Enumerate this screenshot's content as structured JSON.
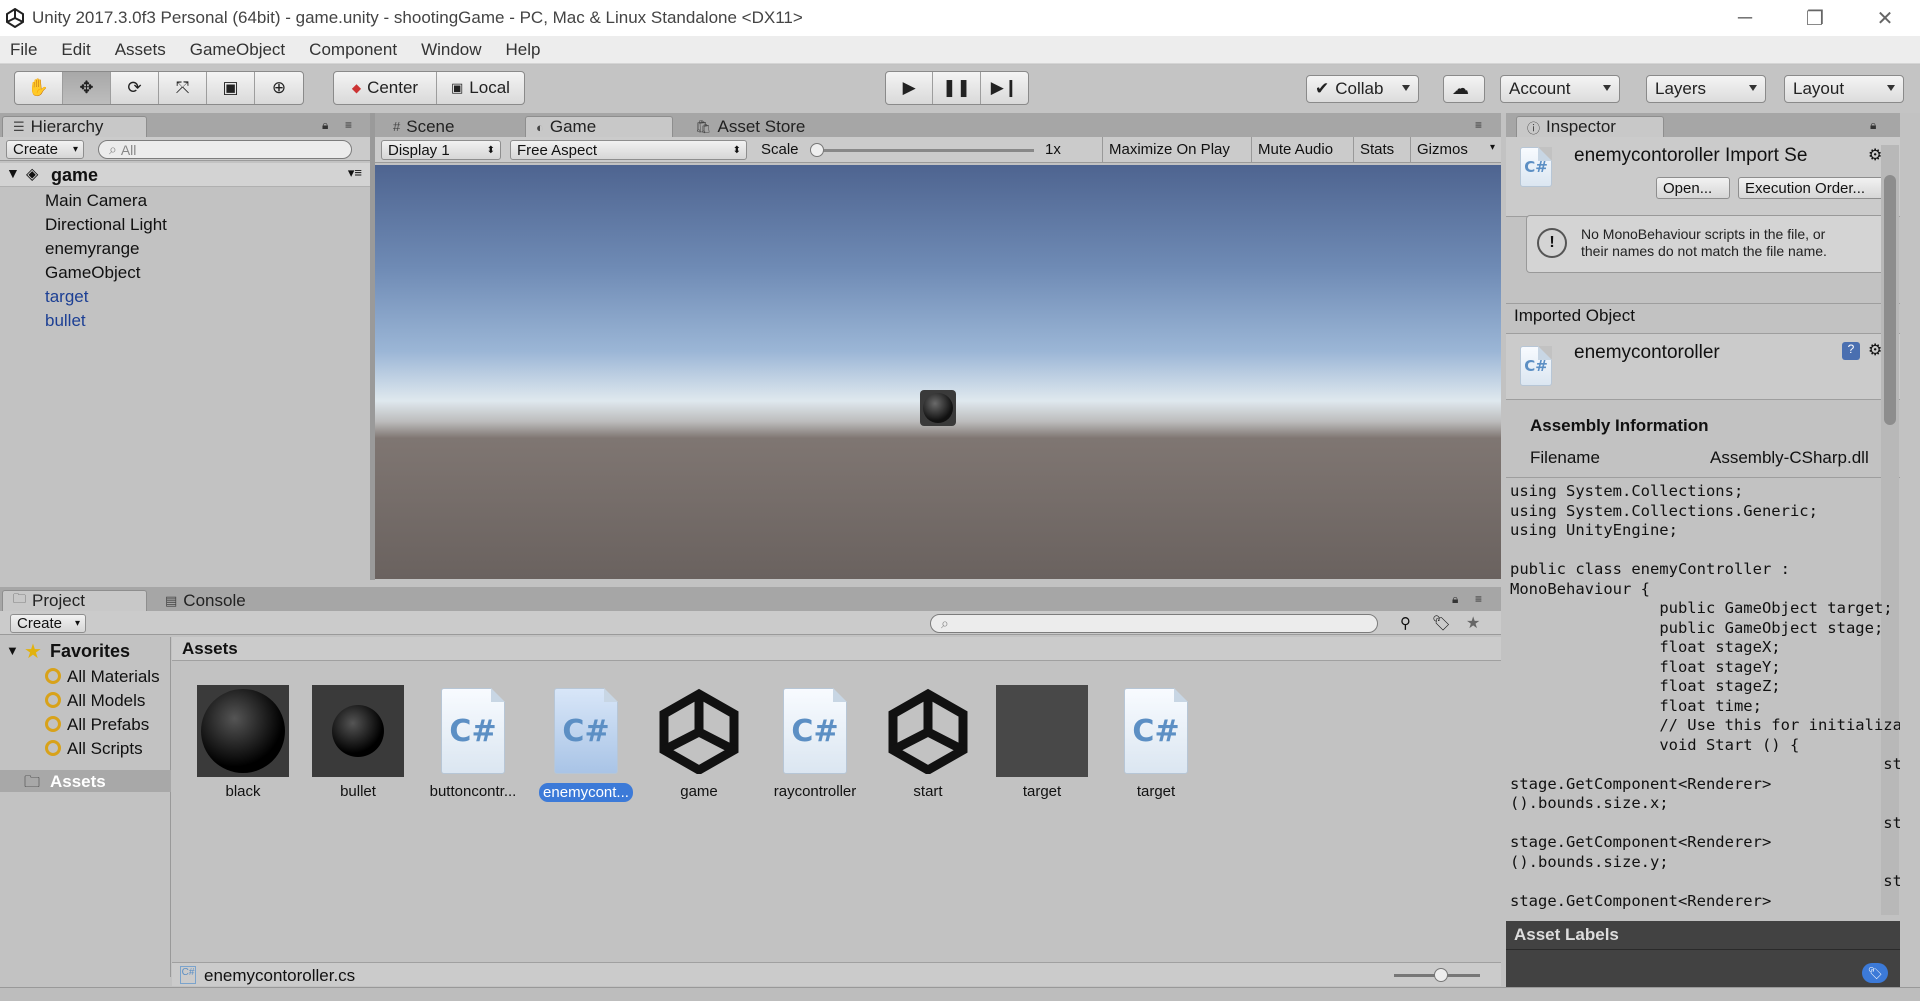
{
  "window": {
    "title": "Unity 2017.3.0f3 Personal (64bit) - game.unity - shootingGame - PC, Mac & Linux Standalone <DX11>"
  },
  "menu": [
    "File",
    "Edit",
    "Assets",
    "GameObject",
    "Component",
    "Window",
    "Help"
  ],
  "toolbar": {
    "pivot": "Center",
    "space": "Local",
    "collab": "Collab",
    "account": "Account",
    "layers": "Layers",
    "layout": "Layout"
  },
  "hierarchy": {
    "tab": "Hierarchy",
    "create": "Create",
    "search_placeholder": "All",
    "scene": "game",
    "items": [
      {
        "label": "Main Camera",
        "color": "#111111"
      },
      {
        "label": "Directional Light",
        "color": "#111111"
      },
      {
        "label": "enemyrange",
        "color": "#111111"
      },
      {
        "label": "GameObject",
        "color": "#111111"
      },
      {
        "label": "target",
        "color": "#1c3f94"
      },
      {
        "label": "bullet",
        "color": "#1c3f94"
      }
    ]
  },
  "center_tabs": {
    "scene": "Scene",
    "game": "Game",
    "asset_store": "Asset Store"
  },
  "game_bar": {
    "display": "Display 1",
    "aspect": "Free Aspect",
    "scale_label": "Scale",
    "scale_value": "1x",
    "maximize": "Maximize On Play",
    "mute": "Mute Audio",
    "stats": "Stats",
    "gizmos": "Gizmos"
  },
  "inspector": {
    "tab": "Inspector",
    "title": "enemycontoroller Import Se",
    "open_button": "Open...",
    "exec_button": "Execution Order...",
    "warning_line1": "No MonoBehaviour scripts in the file, or",
    "warning_line2": "their names do not match the file name.",
    "imported_object": "Imported Object",
    "object_name": "enemycontoroller",
    "assembly_header": "Assembly Information",
    "filename_label": "Filename",
    "filename_value": "Assembly-CSharp.dll",
    "code": "using System.Collections;\nusing System.Collections.Generic;\nusing UnityEngine;\n\npublic class enemyController :\nMonoBehaviour {\n\t\tpublic GameObject target;\n\t\tpublic GameObject stage;\n\t\tfloat stageX;\n\t\tfloat stageY;\n\t\tfloat stageZ;\n\t\tfloat time;\n\t\t// Use this for initialization\n\t\tvoid Start () {\n\t\t\t\t\tstageX =\nstage.GetComponent<Renderer>\n().bounds.size.x;\n\t\t\t\t\tstageY =\nstage.GetComponent<Renderer>\n().bounds.size.y;\n\t\t\t\t\tstageZ =\nstage.GetComponent<Renderer>\n().bounds.size.z;",
    "asset_labels": "Asset Labels"
  },
  "project": {
    "tab_project": "Project",
    "tab_console": "Console",
    "create": "Create",
    "favorites": "Favorites",
    "fav_items": [
      "All Materials",
      "All Models",
      "All Prefabs",
      "All Scripts"
    ],
    "assets_root": "Assets",
    "breadcrumb": "Assets",
    "assets": [
      {
        "label": "black",
        "kind": "sphere"
      },
      {
        "label": "bullet",
        "kind": "sphere-small"
      },
      {
        "label": "buttoncontr...",
        "kind": "cs"
      },
      {
        "label": "enemycont...",
        "kind": "cs",
        "selected": true
      },
      {
        "label": "game",
        "kind": "unity"
      },
      {
        "label": "raycontroller",
        "kind": "cs"
      },
      {
        "label": "start",
        "kind": "unity"
      },
      {
        "label": "target",
        "kind": "square"
      },
      {
        "label": "target",
        "kind": "cs"
      }
    ],
    "status_file": "enemycontoroller.cs"
  }
}
